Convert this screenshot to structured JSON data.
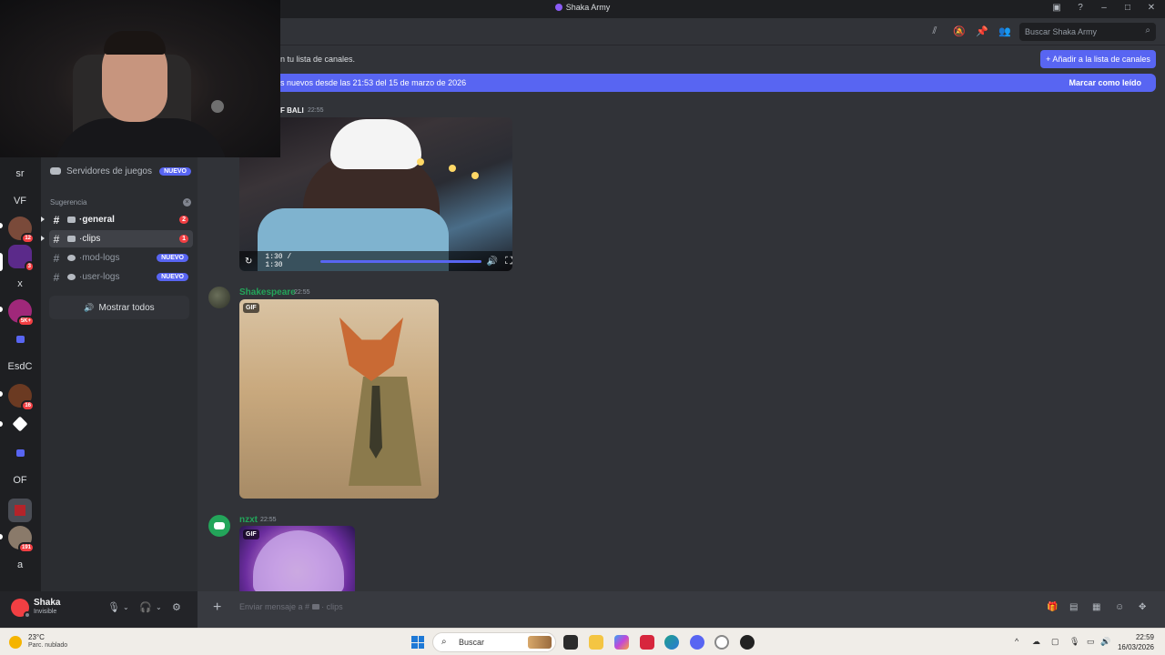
{
  "window": {
    "title": "Shaka Army",
    "controls": [
      "–",
      "□",
      "✕"
    ]
  },
  "rail": {
    "servers": [
      {
        "label": "sr",
        "badge": ""
      },
      {
        "label": "VF",
        "badge": ""
      },
      {
        "label": "",
        "badge": "12"
      },
      {
        "label": "",
        "badge": "3"
      },
      {
        "label": "x",
        "badge": ""
      },
      {
        "label": "",
        "badge": "5K+"
      },
      {
        "label": "",
        "badge": ""
      },
      {
        "label": "EsdC",
        "badge": ""
      },
      {
        "label": "",
        "badge": "16"
      },
      {
        "label": "",
        "badge": ""
      },
      {
        "label": "",
        "badge": ""
      },
      {
        "label": "OF",
        "badge": ""
      },
      {
        "label": "",
        "badge": ""
      },
      {
        "label": "",
        "badge": "191"
      },
      {
        "label": "a",
        "badge": ""
      }
    ]
  },
  "sidebar": {
    "games_label": "Servidores de juegos",
    "new_label": "NUEVO",
    "suggestion_label": "Sugerencia",
    "channels": [
      {
        "name": "general",
        "unread": "2"
      },
      {
        "name": "clips",
        "unread": "1"
      },
      {
        "name": "mod-logs",
        "badge": "NUEVO"
      },
      {
        "name": "user-logs",
        "badge": "NUEVO"
      }
    ],
    "show_all": "Mostrar todos"
  },
  "user": {
    "name": "Shaka",
    "status": "Invisible"
  },
  "header": {
    "search_placeholder": "Buscar Shaka Army"
  },
  "notice": {
    "text": "n tu lista de canales.",
    "add_button": "+ Añadir a la lista de canales"
  },
  "new_messages_bar": {
    "text": "s nuevos desde las 21:53 del 15 de marzo de 2026",
    "mark_read": "Marcar como leído"
  },
  "messages": [
    {
      "author": "F BALI",
      "time": "22:55",
      "video_time": "1:30 / 1:30"
    },
    {
      "author": "Shakespeare",
      "time": "22:55",
      "tag": "GIF"
    },
    {
      "author": "nzxt",
      "time": "22:55",
      "tag": "GIF"
    }
  ],
  "composer": {
    "placeholder": "Enviar mensaje a #",
    "channel": "· clips"
  },
  "taskbar": {
    "temperature": "23°C",
    "condition": "Parc. nublado",
    "search": "Buscar",
    "time": "22:59",
    "date": "16/03/2026"
  },
  "colors": {
    "accent": "#5865f2",
    "author_green": "#23a55a",
    "danger": "#f23f43"
  }
}
